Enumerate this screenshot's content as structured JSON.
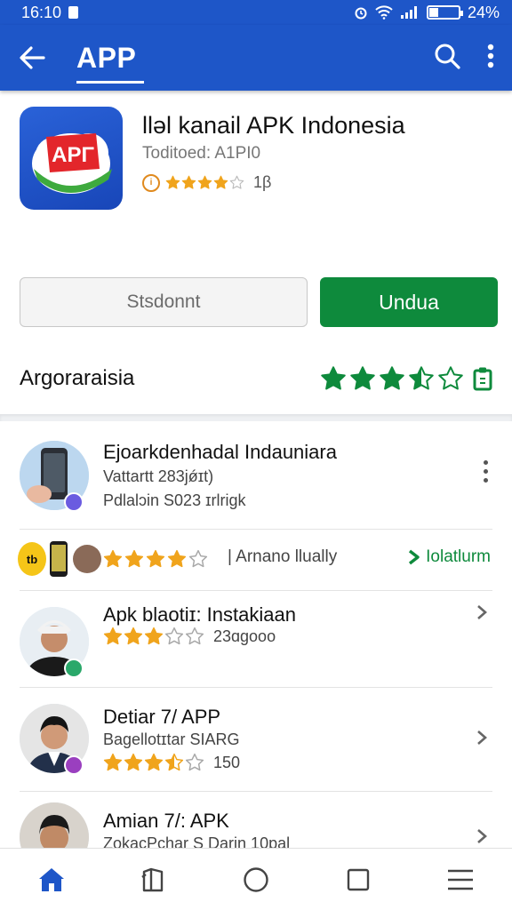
{
  "status_bar": {
    "time": "16:10",
    "battery": "24%"
  },
  "app_bar": {
    "title": "APP",
    "back_icon": "arrow-left-icon",
    "search_icon": "search-icon",
    "menu_icon": "more-vert-icon",
    "color": "#1e56c8"
  },
  "app": {
    "icon_text": "APΓ",
    "name": "lləl kanail APK Indonesia",
    "subtitle": "Toditoed: A1PI0",
    "rating_stars": 4,
    "rating_count": "1β"
  },
  "buttons": {
    "secondary_label": "Stsdonnt",
    "primary_label": "Undua",
    "primary_color": "#0e8a3c"
  },
  "rating_section": {
    "label": "Argoraraisia",
    "stars": 3.5
  },
  "list": [
    {
      "title": "Ejoarkdenhadal Indauniara",
      "line2": "Vattartt 283jǿɪt)",
      "line3": "Pdlalɔin S023 ɪrlrigk"
    },
    {
      "title": "Apk  blaotiɪ: Instakiaan",
      "stars": 3,
      "count": "23ɑgooo"
    },
    {
      "title": "Detiar 7/ APP",
      "line2": "Bagellotɪtar SIARG",
      "stars": 3.5,
      "count": "150"
    },
    {
      "title": "Amian 7/: APK",
      "line2": "ZokacPchar S Darin 10pal"
    }
  ],
  "promo": {
    "stars": 4,
    "text": "|   Arnano llually",
    "link": "Iolatlurm",
    "avatar_label": "tb"
  },
  "bottom_nav": [
    "home-icon",
    "book-icon",
    "circle-icon",
    "square-icon",
    "menu-icon"
  ]
}
